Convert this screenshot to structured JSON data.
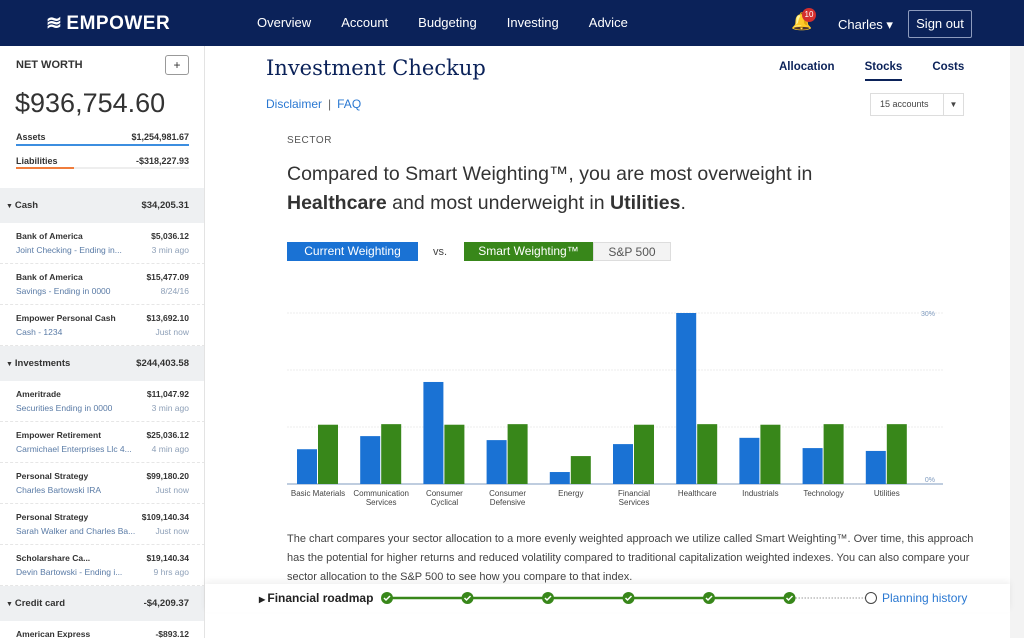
{
  "header": {
    "brand": "EMPOWER",
    "nav": [
      "Overview",
      "Account",
      "Budgeting",
      "Investing",
      "Advice"
    ],
    "notifications": "10",
    "user": "Charles ▾",
    "signout": "Sign out"
  },
  "sidebar": {
    "net_worth_label": "NET WORTH",
    "add": "+",
    "net_worth": "$936,754.60",
    "assets_label": "Assets",
    "assets": "$1,254,981.67",
    "liabilities_label": "Liabilities",
    "liabilities": "-$318,227.93",
    "groups": [
      {
        "name": "Cash",
        "total": "$34,205.31",
        "accounts": [
          {
            "name": "Bank of America",
            "value": "$5,036.12",
            "sub": "Joint Checking - Ending in...",
            "time": "3 min ago"
          },
          {
            "name": "Bank of America",
            "value": "$15,477.09",
            "sub": "Savings - Ending in 0000",
            "time": "8/24/16"
          },
          {
            "name": "Empower Personal Cash",
            "value": "$13,692.10",
            "sub": "Cash - 1234",
            "time": "Just now"
          }
        ]
      },
      {
        "name": "Investments",
        "total": "$244,403.58",
        "accounts": [
          {
            "name": "Ameritrade",
            "value": "$11,047.92",
            "sub": "Securities Ending in 0000",
            "time": "3 min ago"
          },
          {
            "name": "Empower Retirement",
            "value": "$25,036.12",
            "sub": "Carmichael Enterprises Llc 4...",
            "time": "4 min ago"
          },
          {
            "name": "Personal Strategy",
            "value": "$99,180.20",
            "sub": "Charles Bartowski IRA",
            "time": "Just now"
          },
          {
            "name": "Personal Strategy",
            "value": "$109,140.34",
            "sub": "Sarah Walker and Charles Ba...",
            "time": "Just now"
          },
          {
            "name": "Scholarshare Ca...",
            "value": "$19,140.34",
            "sub": "Devin Bartowski - Ending i...",
            "time": "9 hrs ago"
          }
        ]
      },
      {
        "name": "Credit card",
        "total": "-$4,209.37",
        "accounts": [
          {
            "name": "American Express",
            "value": "-$893.12",
            "sub": "",
            "time": ""
          }
        ]
      }
    ]
  },
  "main": {
    "title": "Investment Checkup",
    "tabs": [
      "Allocation",
      "Stocks",
      "Costs"
    ],
    "active_tab": "Stocks",
    "disclaimer": "Disclaimer",
    "sep": "|",
    "faq": "FAQ",
    "accounts_select": "15 accounts",
    "section": "SECTOR",
    "headline_1": "Compared to Smart Weighting™, you are most overweight in",
    "headline_b1": "Healthcare",
    "headline_2": " and most underweight in ",
    "headline_b2": "Utilities",
    "headline_3": ".",
    "btn_current": "Current Weighting",
    "vs": "vs.",
    "btn_smart": "Smart Weighting™",
    "btn_sp": "S&P 500",
    "paragraph": "The chart compares your sector allocation to a more evenly weighted approach we utilize called Smart Weighting™. Over time, this approach has the potential for higher returns and reduced volatility compared to traditional capitalization weighted indexes. You can also compare your sector allocation to the S&P 500 to see how you compare to that index.",
    "roadmap": "Financial roadmap",
    "planning": "Planning history",
    "roadmap_steps_complete": 6
  },
  "colors": {
    "navy": "#0b2259",
    "current": "#1a72d4",
    "smart": "#38871a",
    "link": "#2a78d2"
  },
  "chart_data": {
    "type": "bar",
    "categories": [
      "Basic Materials",
      "Communication Services",
      "Consumer Cyclical",
      "Consumer Defensive",
      "Energy",
      "Financial Services",
      "Healthcare",
      "Industrials",
      "Technology",
      "Utilities"
    ],
    "series": [
      {
        "name": "Current Weighting",
        "values": [
          6.1,
          8.4,
          17.9,
          7.7,
          2.1,
          7.0,
          30.0,
          8.1,
          6.3,
          5.8
        ]
      },
      {
        "name": "Smart Weighting™",
        "values": [
          10.4,
          10.5,
          10.4,
          10.5,
          4.9,
          10.4,
          10.5,
          10.4,
          10.5,
          10.5
        ]
      }
    ],
    "ylim": [
      0,
      30
    ],
    "yticks": [
      "0%",
      "30%"
    ],
    "grid": true
  }
}
